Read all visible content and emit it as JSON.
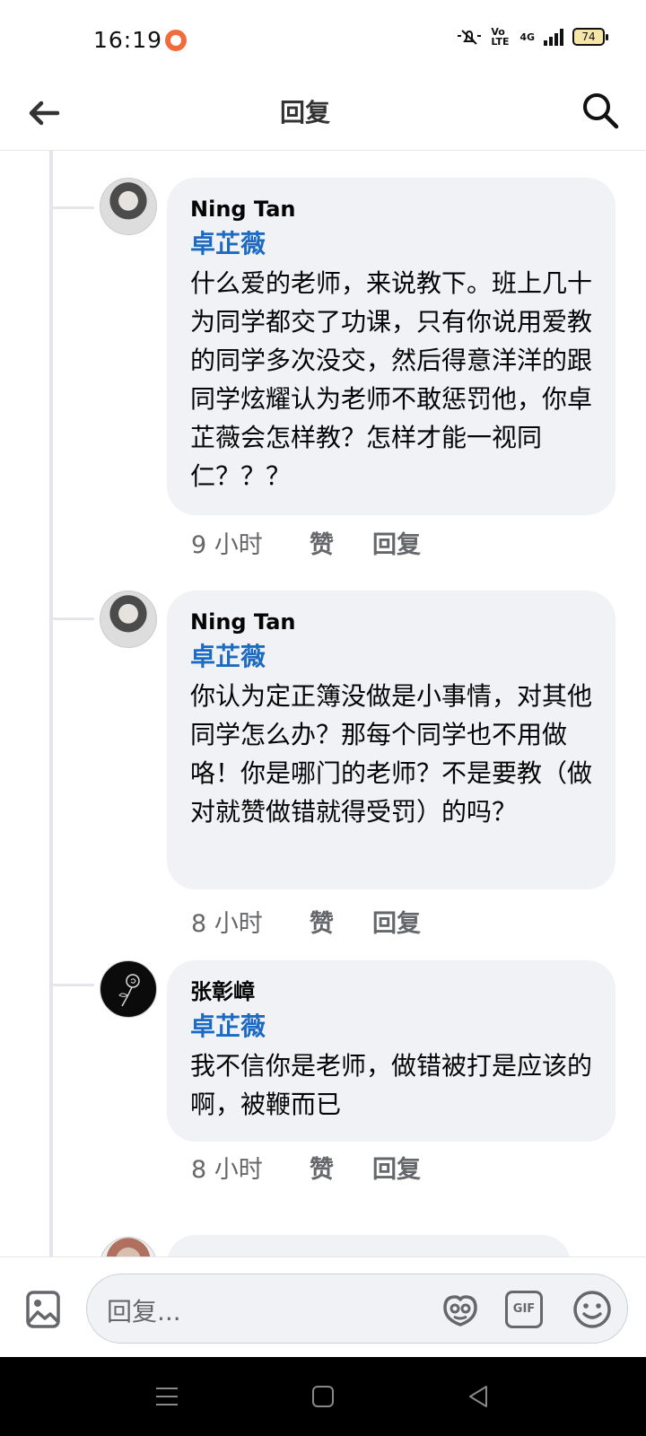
{
  "status_bar": {
    "time": "16:19",
    "network": "4G",
    "volte": "Vo LTE",
    "battery": "74"
  },
  "header": {
    "title": "回复"
  },
  "comments": [
    {
      "author": "Ning Tan",
      "mention": "卓芷薇",
      "text": "什么爱的老师，来说教下。班上几十为同学都交了功课，只有你说用爱教的同学多次没交，然后得意洋洋的跟同学炫耀认为老师不敢惩罚他，你卓芷薇会怎样教？怎样才能一视同仁？？？",
      "time": "9 小时",
      "like_label": "赞",
      "reply_label": "回复"
    },
    {
      "author": "Ning Tan",
      "mention": "卓芷薇",
      "text": "你认为定正簿没做是小事情，对其他同学怎么办？那每个同学也不用做咯！你是哪门的老师？不是要教（做对就赞做错就得受罚）的吗？",
      "time": "8 小时",
      "like_label": "赞",
      "reply_label": "回复"
    },
    {
      "author": "张彰嶂",
      "mention": "卓芷薇",
      "text": "我不信你是老师，做错被打是应该的啊，被鞭而已",
      "time": "8 小时",
      "like_label": "赞",
      "reply_label": "回复"
    }
  ],
  "composer": {
    "placeholder": "回复..."
  },
  "colors": {
    "mention": "#1c6ac2",
    "bubble": "#f0f2f5",
    "meta": "#65676b",
    "nav_bar": "#000000"
  },
  "icons": [
    "back-arrow-icon",
    "search-icon",
    "photo-icon",
    "sticker-icon",
    "gif-icon",
    "emoji-icon",
    "nav-menu-icon",
    "nav-home-icon",
    "nav-back-icon"
  ]
}
